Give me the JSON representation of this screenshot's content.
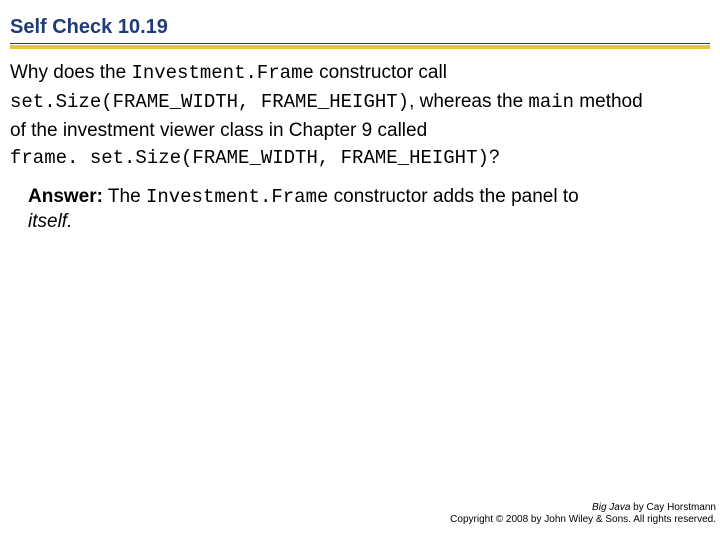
{
  "title": "Self Check 10.19",
  "question": {
    "pre1": "Why does the ",
    "code1": "Investment.Frame",
    "post1": " constructor call",
    "code2": "set.Size(FRAME_WIDTH, FRAME_HEIGHT)",
    "mid2": ", whereas the ",
    "code_main": "main",
    "post2": " method",
    "line3": "of the investment viewer class in Chapter 9 called",
    "code4": "frame. set.Size(FRAME_WIDTH, FRAME_HEIGHT)",
    "post4": "?"
  },
  "answer": {
    "label": "Answer:",
    "pre": " The ",
    "code": "Investment.Frame",
    "post": " constructor adds the panel to",
    "tail": "itself."
  },
  "footer": {
    "book": "Big Java",
    "byline": " by Cay Horstmann",
    "copyright": "Copyright © 2008 by John Wiley & Sons. All rights reserved."
  }
}
